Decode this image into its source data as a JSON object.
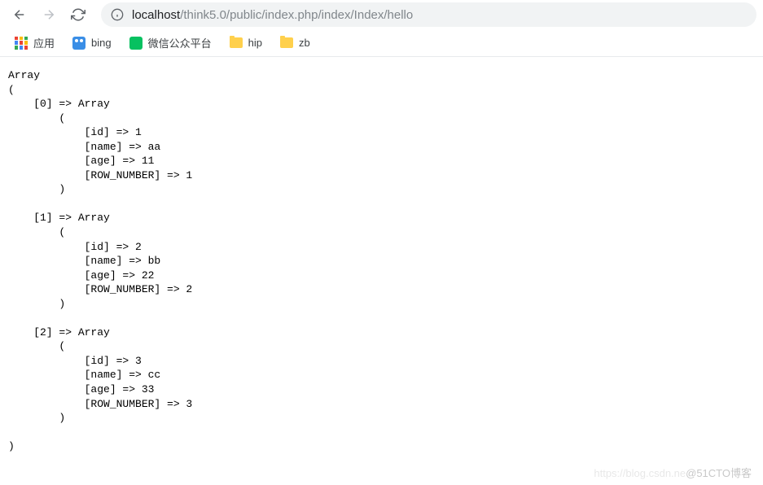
{
  "nav": {
    "url_dark": "localhost",
    "url_gray": "/think5.0/public/index.php/index/Index/hello"
  },
  "bookmarks": {
    "apps": "应用",
    "bing": "bing",
    "wechat": "微信公众平台",
    "hip": "hip",
    "zb": "zb"
  },
  "array_data": [
    {
      "id": 1,
      "name": "aa",
      "age": 11,
      "ROW_NUMBER": 1
    },
    {
      "id": 2,
      "name": "bb",
      "age": 22,
      "ROW_NUMBER": 2
    },
    {
      "id": 3,
      "name": "cc",
      "age": 33,
      "ROW_NUMBER": 3
    }
  ],
  "watermark": {
    "faded": "https://blog.csdn.ne",
    "main": "@51CTO博客"
  }
}
